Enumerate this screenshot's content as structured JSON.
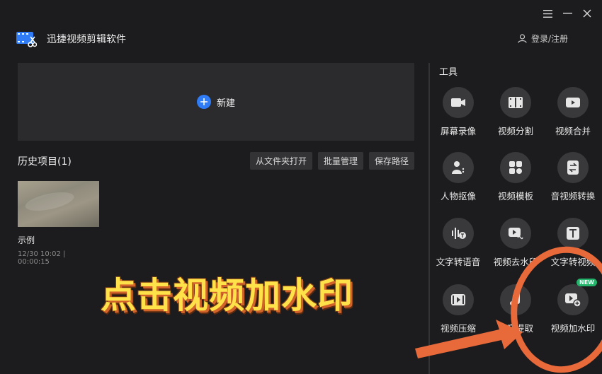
{
  "app": {
    "name": "迅捷视频剪辑软件"
  },
  "window_controls": {
    "menu_icon": "hamburger-icon",
    "minimize_icon": "minimize-icon",
    "close_icon": "close-icon"
  },
  "account": {
    "login_label": "登录/注册",
    "icon": "user-icon"
  },
  "create": {
    "label": "新建",
    "icon": "plus-circle-icon"
  },
  "history": {
    "title": "历史项目(1)",
    "actions": [
      "从文件夹打开",
      "批量管理",
      "保存路径"
    ],
    "projects": [
      {
        "name": "示例",
        "meta": "12/30 10:02 | 00:00:15"
      }
    ]
  },
  "tools": {
    "title": "工具",
    "items": [
      {
        "label": "屏幕录像",
        "icon": "camera-icon"
      },
      {
        "label": "视频分割",
        "icon": "film-split-icon"
      },
      {
        "label": "视频合并",
        "icon": "video-merge-icon"
      },
      {
        "label": "人物抠像",
        "icon": "person-cutout-icon"
      },
      {
        "label": "视频模板",
        "icon": "template-icon"
      },
      {
        "label": "音视频转换",
        "icon": "convert-icon"
      },
      {
        "label": "文字转语音",
        "icon": "text-to-speech-icon"
      },
      {
        "label": "视频去水印",
        "icon": "remove-watermark-icon"
      },
      {
        "label": "文字转视频",
        "icon": "text-to-video-icon"
      },
      {
        "label": "视频压缩",
        "icon": "compress-icon"
      },
      {
        "label": "声音提取",
        "icon": "audio-extract-icon"
      },
      {
        "label": "视频加水印",
        "icon": "add-watermark-icon",
        "badge": "NEW"
      }
    ]
  },
  "overlay": {
    "caption": "点击视频加水印",
    "arrow_color": "#e8693a",
    "circle_color": "#e8693a"
  },
  "colors": {
    "accent": "#2f7cf6",
    "badge": "#23b36a",
    "background": "#1c1c1e"
  }
}
